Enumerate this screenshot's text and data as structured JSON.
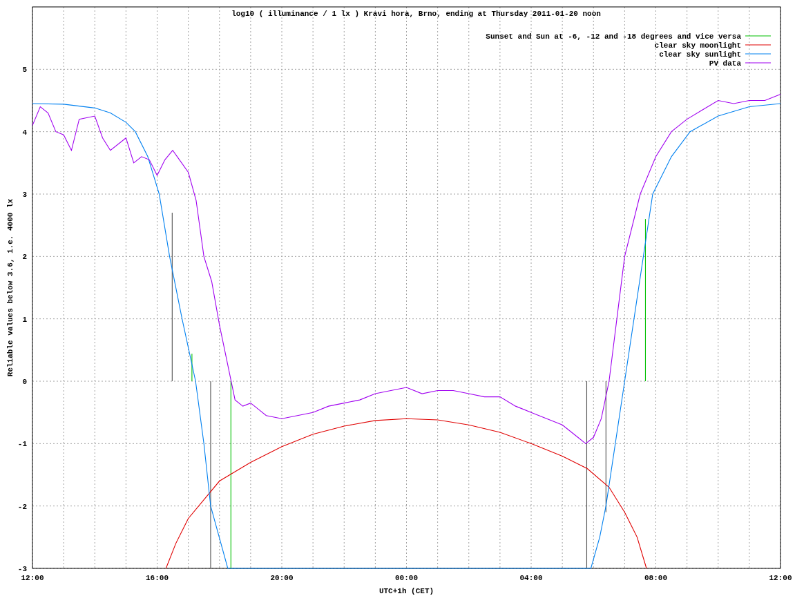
{
  "chart_data": {
    "type": "line",
    "title": "log10 ( illuminance / 1 lx ) Kravi hora, Brno, ending at Thursday 2011-01-20 noon",
    "xlabel": "UTC+1h (CET)",
    "ylabel": "Reliable values below 3.6, i.e. 4000 lx",
    "xlim": [
      "2011-01-19T12:00",
      "2011-01-20T12:00"
    ],
    "ylim": [
      -3,
      6
    ],
    "grid": true,
    "legend": true,
    "xticks": [
      {
        "value": "2011-01-19T12:00",
        "label": "12:00"
      },
      {
        "value": "2011-01-19T16:00",
        "label": "16:00"
      },
      {
        "value": "2011-01-19T20:00",
        "label": "20:00"
      },
      {
        "value": "2011-01-20T00:00",
        "label": "00:00"
      },
      {
        "value": "2011-01-20T04:00",
        "label": "04:00"
      },
      {
        "value": "2011-01-20T08:00",
        "label": "08:00"
      },
      {
        "value": "2011-01-20T12:00",
        "label": "12:00"
      }
    ],
    "yticks": [
      -3,
      -2,
      -1,
      0,
      1,
      2,
      3,
      4,
      5
    ],
    "series": [
      {
        "name": "Sunset and Sun at -6, -12 and -18 degrees and vice versa",
        "color": "#00c000",
        "x": [
          "2011-01-19T17:07",
          "2011-01-19T17:07"
        ],
        "values": [
          0,
          0.44
        ]
      },
      {
        "color": "#00c000",
        "x": [
          "2011-01-19T18:22",
          "2011-01-19T18:22"
        ],
        "values": [
          0,
          -3
        ]
      },
      {
        "color": "#00c000",
        "x": [
          "2011-01-20T07:40",
          "2011-01-20T07:40"
        ],
        "values": [
          0,
          2.6
        ]
      },
      {
        "color": "#505050",
        "x": [
          "2011-01-19T16:29",
          "2011-01-19T16:29"
        ],
        "values": [
          0,
          2.7
        ]
      },
      {
        "color": "#505050",
        "x": [
          "2011-01-19T17:43",
          "2011-01-19T17:43"
        ],
        "values": [
          0,
          -3
        ]
      },
      {
        "color": "#505050",
        "x": [
          "2011-01-20T05:47",
          "2011-01-20T05:47"
        ],
        "values": [
          0,
          -3
        ]
      },
      {
        "color": "#505050",
        "x": [
          "2011-01-20T06:24",
          "2011-01-20T06:24"
        ],
        "values": [
          0,
          -2.1
        ]
      },
      {
        "name": "clear sky moonlight",
        "color": "#e00000",
        "x": [
          "2011-01-19T16:17",
          "2011-01-19T16:36",
          "2011-01-19T17:00",
          "2011-01-19T17:30",
          "2011-01-19T18:00",
          "2011-01-19T19:00",
          "2011-01-19T20:00",
          "2011-01-19T21:00",
          "2011-01-19T22:00",
          "2011-01-19T23:00",
          "2011-01-20T00:00",
          "2011-01-20T01:00",
          "2011-01-20T02:00",
          "2011-01-20T03:00",
          "2011-01-20T04:00",
          "2011-01-20T05:00",
          "2011-01-20T05:48",
          "2011-01-20T06:30",
          "2011-01-20T07:00",
          "2011-01-20T07:24",
          "2011-01-20T07:42"
        ],
        "values": [
          -3,
          -2.6,
          -2.2,
          -1.9,
          -1.6,
          -1.3,
          -1.05,
          -0.85,
          -0.72,
          -0.63,
          -0.6,
          -0.62,
          -0.7,
          -0.82,
          -1,
          -1.2,
          -1.4,
          -1.7,
          -2.1,
          -2.5,
          -3
        ]
      },
      {
        "name": "clear sky sunlight",
        "color": "#0080f0",
        "x": [
          "2011-01-19T12:00",
          "2011-01-19T13:00",
          "2011-01-19T14:00",
          "2011-01-19T14:30",
          "2011-01-19T15:00",
          "2011-01-19T15:18",
          "2011-01-19T15:42",
          "2011-01-19T16:04",
          "2011-01-19T16:24",
          "2011-01-19T16:48",
          "2011-01-19T17:14",
          "2011-01-19T17:30",
          "2011-01-19T17:43",
          "2011-01-19T18:16",
          "2011-01-20T05:55",
          "2011-01-20T06:12",
          "2011-01-20T06:24",
          "2011-01-20T06:42",
          "2011-01-20T07:00",
          "2011-01-20T07:18",
          "2011-01-20T07:36",
          "2011-01-20T07:54",
          "2011-01-20T08:30",
          "2011-01-20T09:06",
          "2011-01-20T10:00",
          "2011-01-20T11:00",
          "2011-01-20T12:00"
        ],
        "values": [
          4.45,
          4.44,
          4.38,
          4.3,
          4.15,
          4,
          3.6,
          3,
          2,
          1,
          0,
          -1,
          -2,
          -3,
          -3,
          -2.5,
          -2,
          -1,
          0,
          1,
          2,
          3,
          3.6,
          4,
          4.25,
          4.4,
          4.45
        ]
      },
      {
        "name": "PV data",
        "color": "#a000f0",
        "x": [
          "2011-01-19T12:00",
          "2011-01-19T12:15",
          "2011-01-19T12:30",
          "2011-01-19T12:45",
          "2011-01-19T13:00",
          "2011-01-19T13:15",
          "2011-01-19T13:30",
          "2011-01-19T14:00",
          "2011-01-19T14:15",
          "2011-01-19T14:30",
          "2011-01-19T15:00",
          "2011-01-19T15:15",
          "2011-01-19T15:30",
          "2011-01-19T15:45",
          "2011-01-19T16:00",
          "2011-01-19T16:15",
          "2011-01-19T16:30",
          "2011-01-19T17:00",
          "2011-01-19T17:15",
          "2011-01-19T17:30",
          "2011-01-19T17:45",
          "2011-01-19T18:00",
          "2011-01-19T18:15",
          "2011-01-19T18:30",
          "2011-01-19T18:45",
          "2011-01-19T19:00",
          "2011-01-19T19:15",
          "2011-01-19T19:30",
          "2011-01-19T20:00",
          "2011-01-19T20:30",
          "2011-01-19T21:00",
          "2011-01-19T21:30",
          "2011-01-19T22:00",
          "2011-01-19T22:30",
          "2011-01-19T23:00",
          "2011-01-19T23:30",
          "2011-01-20T00:00",
          "2011-01-20T00:30",
          "2011-01-20T01:00",
          "2011-01-20T01:30",
          "2011-01-20T02:00",
          "2011-01-20T02:30",
          "2011-01-20T03:00",
          "2011-01-20T03:30",
          "2011-01-20T04:00",
          "2011-01-20T04:30",
          "2011-01-20T05:00",
          "2011-01-20T05:30",
          "2011-01-20T05:45",
          "2011-01-20T06:00",
          "2011-01-20T06:15",
          "2011-01-20T06:30",
          "2011-01-20T06:45",
          "2011-01-20T07:00",
          "2011-01-20T07:30",
          "2011-01-20T08:00",
          "2011-01-20T08:30",
          "2011-01-20T09:00",
          "2011-01-20T09:30",
          "2011-01-20T10:00",
          "2011-01-20T10:30",
          "2011-01-20T11:00",
          "2011-01-20T11:30",
          "2011-01-20T12:00"
        ],
        "values": [
          4.1,
          4.4,
          4.3,
          4,
          3.95,
          3.7,
          4.2,
          4.25,
          3.9,
          3.7,
          3.9,
          3.5,
          3.6,
          3.55,
          3.3,
          3.55,
          3.7,
          3.35,
          2.9,
          2,
          1.6,
          0.9,
          0.3,
          -0.3,
          -0.4,
          -0.35,
          -0.45,
          -0.55,
          -0.6,
          -0.55,
          -0.5,
          -0.4,
          -0.35,
          -0.3,
          -0.2,
          -0.15,
          -0.1,
          -0.2,
          -0.15,
          -0.15,
          -0.2,
          -0.25,
          -0.25,
          -0.4,
          -0.5,
          -0.6,
          -0.7,
          -0.9,
          -1,
          -0.9,
          -0.6,
          0,
          1,
          2,
          3,
          3.6,
          4,
          4.2,
          4.35,
          4.5,
          4.45,
          4.5,
          4.5,
          4.6
        ]
      }
    ]
  }
}
